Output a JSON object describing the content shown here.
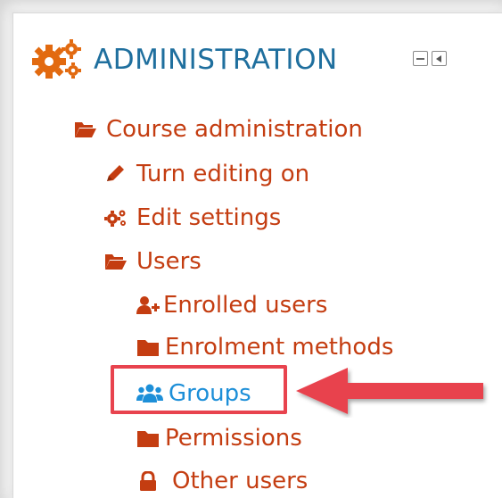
{
  "block": {
    "title": "ADMINISTRATION",
    "controls": [
      "minimize-block",
      "dock-block"
    ]
  },
  "tree": {
    "course_administration": "Course administration",
    "turn_editing_on": "Turn editing on",
    "edit_settings": "Edit settings",
    "users": "Users",
    "enrolled_users": "Enrolled users",
    "enrolment_methods": "Enrolment methods",
    "groups": "Groups",
    "permissions": "Permissions",
    "other_users": "Other users"
  },
  "colors": {
    "link": "#c43d11",
    "link_active": "#1d8fd8",
    "header": "#1f6f9e",
    "header_icon": "#e26a10",
    "callout": "#e8434e"
  },
  "icons": {
    "header": "gears-icon",
    "course_administration": "folder-open-icon",
    "turn_editing_on": "pencil-icon",
    "edit_settings": "gears-icon",
    "users": "folder-open-icon",
    "enrolled_users": "user-plus-icon",
    "enrolment_methods": "folder-icon",
    "groups": "users-icon",
    "permissions": "folder-icon",
    "other_users": "lock-icon"
  }
}
